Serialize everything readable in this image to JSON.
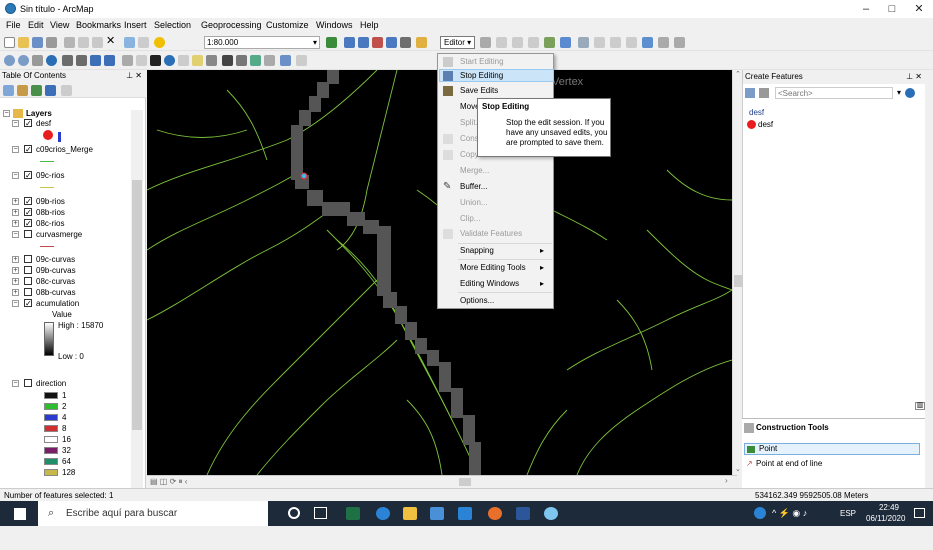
{
  "window": {
    "title": "Sin título - ArcMap",
    "minimize": "–",
    "maximize": "□",
    "close": "✕"
  },
  "menu": [
    "File",
    "Edit",
    "View",
    "Bookmarks",
    "Insert",
    "Selection",
    "Geoprocessing",
    "Customize",
    "Windows",
    "Help"
  ],
  "toolbar": {
    "scale": "1:80.000",
    "editor": "Editor ▾"
  },
  "toc": {
    "title": "Table Of Contents",
    "root": "Layers",
    "layers": [
      "desf",
      "c09crios_Merge",
      "09c-rios",
      "09b-rios",
      "08b-rios",
      "08c-rios",
      "curvasmerge",
      "09c-curvas",
      "09b-curvas",
      "08c-curvas",
      "08b-curvas",
      "acumulation",
      "direction"
    ],
    "accum_value": "Value",
    "accum_high": "High : 15870",
    "accum_low": "Low : 0",
    "direction_values": [
      "1",
      "2",
      "4",
      "8",
      "16",
      "32",
      "64",
      "128"
    ],
    "direction_colors": [
      "#111111",
      "#2dbd2d",
      "#2b3bd0",
      "#d02f2f",
      "#ffffff",
      "#7a1e6a",
      "#1f8f6a",
      "#c8b84a"
    ]
  },
  "map": {
    "vertex_label": "Vertex"
  },
  "edit_menu": {
    "items": [
      {
        "label": "Start Editing",
        "enabled": false
      },
      {
        "label": "Stop Editing",
        "enabled": true
      },
      {
        "label": "Save Edits",
        "enabled": true
      },
      {
        "label": "Move...",
        "enabled": true
      },
      {
        "label": "Split...",
        "enabled": false
      },
      {
        "label": "Construct Points...",
        "enabled": false
      },
      {
        "label": "Copy Parallel...",
        "enabled": false
      },
      {
        "label": "Merge...",
        "enabled": false
      },
      {
        "label": "Buffer...",
        "enabled": true
      },
      {
        "label": "Union...",
        "enabled": false
      },
      {
        "label": "Clip...",
        "enabled": false
      },
      {
        "label": "Validate Features",
        "enabled": false
      },
      {
        "label": "Snapping",
        "enabled": true,
        "submenu": true
      },
      {
        "label": "More Editing Tools",
        "enabled": true,
        "submenu": true
      },
      {
        "label": "Editing Windows",
        "enabled": true,
        "submenu": true
      },
      {
        "label": "Options...",
        "enabled": true
      }
    ],
    "tooltip_title": "Stop Editing",
    "tooltip_text": "Stop the edit session. If you have any unsaved edits, you are prompted to save them."
  },
  "create_features": {
    "title": "Create Features",
    "search_placeholder": "<Search>",
    "group": "desf",
    "item": "desf"
  },
  "construction_tools": {
    "title": "Construction Tools",
    "tool1": "Point",
    "tool2": "Point at end of line"
  },
  "status": {
    "selected": "Number of features selected: 1",
    "coords": "534162.349  9592505.08 Meters"
  },
  "taskbar": {
    "search": "Escribe aquí para buscar",
    "lang": "ESP",
    "time": "22:49",
    "date": "06/11/2020"
  }
}
